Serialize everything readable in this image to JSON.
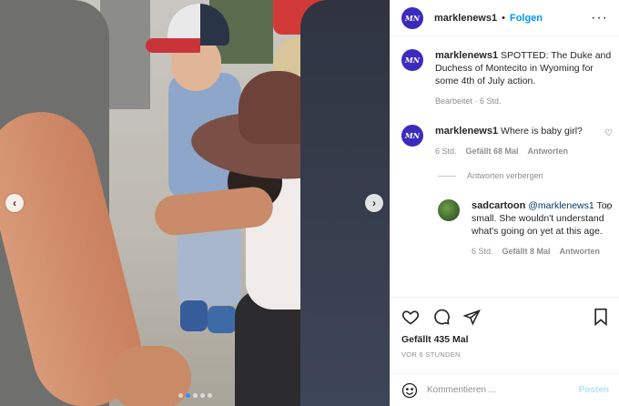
{
  "post": {
    "username": "marklenews1",
    "avatar_text": "MN",
    "follow_label": "Folgen",
    "caption": "SPOTTED: The Duke and Duchess of Montecito in Wyoming for some 4th of July action.",
    "caption_meta": "Bearbeitet · 6 Std.",
    "likes": "Gefällt 435 Mal",
    "time_ago": "VOR 6 STUNDEN"
  },
  "carousel": {
    "dots_total": 5,
    "active_dot": 1
  },
  "comments": [
    {
      "username": "marklenews1",
      "text": "Where is baby girl?",
      "time": "6 Std.",
      "likes": "Gefällt 68 Mal",
      "reply_label": "Antworten"
    }
  ],
  "replies_toggle": "Antworten verbergen",
  "replies": [
    {
      "username": "sadcartoon",
      "mention": "@marklenews1",
      "text": "Too small. She wouldn't understand what's going on yet at this age.",
      "time": "6 Std.",
      "likes": "Gefällt 8 Mal",
      "reply_label": "Antworten"
    }
  ],
  "add_comment": {
    "placeholder": "Kommentieren ...",
    "post_label": "Posten"
  },
  "colors": {
    "accent": "#0095f6",
    "avatar_bg": "#3b2bbd"
  }
}
